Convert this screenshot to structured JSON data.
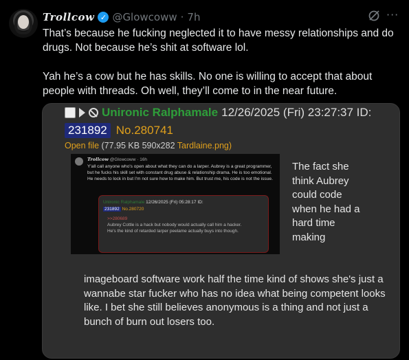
{
  "post": {
    "display_name": "Trollcow",
    "verified_glyph": "✓",
    "handle": "@Glowcoww",
    "separator": "·",
    "timestamp": "7h",
    "more_glyph": "···",
    "paragraphs": [
      "That’s because he fucking neglected it to have messy relationships and do drugs. Not because he’s shit at software lol.",
      "Yah he’s a cow but he has skills. No one is willing to accept that about people with threads. Oh well, they’ll come to in the near future."
    ]
  },
  "media": {
    "poster": "Unironic Ralphamale",
    "datetime": "12/26/2025 (Fri) 23:27:37 ID:",
    "id": "231892",
    "post_number": "No.280741",
    "file_prefix": "Open file",
    "file_meta": "(77.95 KB 590x282",
    "file_name": "Tardlaine.png)",
    "side_text": "The fact she think Aubrey could code when he had a hard time making",
    "bottom_text": "imageboard software work half the time kind of shows she's just a wannabe star fucker who has no idea what being competent looks like. I bet she still believes anonymous is a thing and not just a bunch of burn out losers too.",
    "thumb": {
      "name": "Trollcow",
      "meta": "@Glowcoww · 16h",
      "text": "Y'all call anyone who's open about what they can do a larper. Aubrey is a great programmer, but he fucks his skill set with constant drug abuse & relationship drama. He is too emotional. He needs to lock in but I'm not sure how to make him. But trust me, his code is not the issue.",
      "inner_poster": "Unironic Ralphamale",
      "inner_datetime": "12/26/2025 (Fri) 05:28:17 ID:",
      "inner_id": "231892",
      "inner_no": "No.280720",
      "inner_quote": ">>280689",
      "inner_body": "Aubrey Cottle is a hack but nobody would actually call him a hacker. He's the kind of retarded larper peelame actually buys into though."
    }
  },
  "colors": {
    "background": "#000000",
    "text": "#e7e9ea",
    "muted": "#71767b",
    "verified": "#1d9bf0",
    "poster_green": "#2e9e3a",
    "post_orange": "#e0a01c",
    "id_blue": "#1f2a7a"
  }
}
